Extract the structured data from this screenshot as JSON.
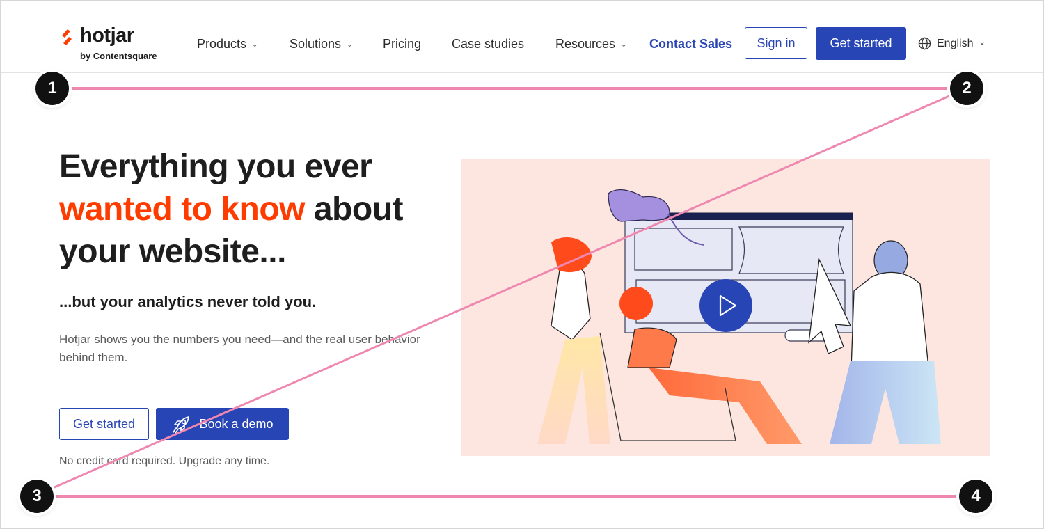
{
  "header": {
    "logo_word": "hotjar",
    "logo_sub": "by Contentsquare",
    "nav": {
      "products": "Products",
      "solutions": "Solutions",
      "pricing": "Pricing",
      "case_studies": "Case studies",
      "resources": "Resources"
    },
    "contact_sales": "Contact Sales",
    "sign_in": "Sign in",
    "get_started": "Get started",
    "language": "English"
  },
  "hero": {
    "title_line1": "Everything you ever",
    "title_accent": "wanted to know",
    "title_line2_rest": " about",
    "title_line3": "your website...",
    "subtitle": "...but your analytics never told you.",
    "description": "Hotjar shows you the numbers you need—and the real user behavior behind them.",
    "get_started": "Get started",
    "book_demo": "Book a demo",
    "note": "No credit card required. Upgrade any time."
  },
  "markers": [
    "1",
    "2",
    "3",
    "4"
  ],
  "colors": {
    "brand_blue": "#2845b5",
    "accent_orange": "#ff3c00",
    "illustration_bg": "#fde6df",
    "annotation_pink": "#ee88b0"
  },
  "icons": [
    "hotjar-logo-icon",
    "chevron-down-icon",
    "globe-icon",
    "rocket-icon",
    "play-icon"
  ]
}
